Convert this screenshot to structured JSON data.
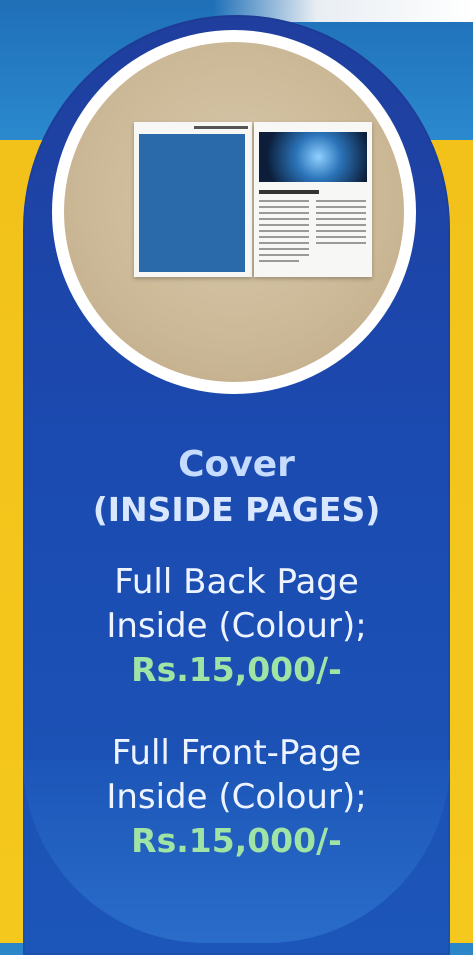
{
  "heading": "Cover",
  "subheading": "(INSIDE PAGES)",
  "offers": [
    {
      "line1": "Full Back Page",
      "line2": "Inside (Colour);",
      "price": "Rs.15,000/-"
    },
    {
      "line1": "Full Front-Page",
      "line2": "Inside (Colour);",
      "price": "Rs.15,000/-"
    }
  ],
  "colors": {
    "pill": "#1f4aa8",
    "heading": "#c6dcff",
    "price": "#9fe3a5",
    "background_yellow": "#f5c81d",
    "background_blue": "#2a86c8"
  }
}
